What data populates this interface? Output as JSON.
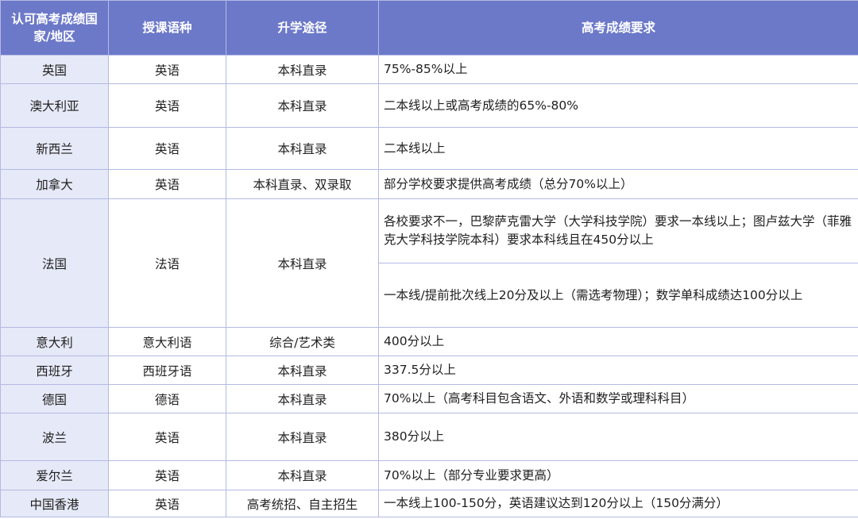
{
  "header": {
    "col1": "认可高考成绩国家/地区",
    "col2": "授课语种",
    "col3": "升学途径",
    "col4": "高考成绩要求"
  },
  "rows": [
    {
      "country": "英国",
      "lang": "英语",
      "path": "本科直录",
      "req": "75%-85%以上"
    },
    {
      "country": "澳大利亚",
      "lang": "英语",
      "path": "本科直录",
      "req": "二本线以上或高考成绩的65%-80%"
    },
    {
      "country": "新西兰",
      "lang": "英语",
      "path": "本科直录",
      "req": "二本线以上"
    },
    {
      "country": "加拿大",
      "lang": "英语",
      "path": "本科直录、双录取",
      "req": "部分学校要求提供高考成绩（总分70%以上）"
    },
    {
      "country": "法国",
      "lang": "法语",
      "path": "本科直录",
      "req": "各校要求不一，巴黎萨克雷大学（大学科技学院）要求一本线以上；图卢兹大学（菲雅克大学科技学院本科）要求本科线且在450分以上",
      "req2": "一本线/提前批次线上20分及以上（需选考物理）；数学单科成绩达100分以上"
    },
    {
      "country": "意大利",
      "lang": "意大利语",
      "path": "综合/艺术类",
      "req": "400分以上"
    },
    {
      "country": "西班牙",
      "lang": "西班牙语",
      "path": "本科直录",
      "req": "337.5分以上"
    },
    {
      "country": "德国",
      "lang": "德语",
      "path": "本科直录",
      "req": "70%以上（高考科目包含语文、外语和数学或理科科目）"
    },
    {
      "country": "波兰",
      "lang": "英语",
      "path": "本科直录",
      "req": "380分以上"
    },
    {
      "country": "爱尔兰",
      "lang": "英语",
      "path": "本科直录",
      "req": "70%以上（部分专业要求更高）"
    },
    {
      "country": "中国香港",
      "lang": "英语",
      "path": "高考统招、自主招生",
      "req": "一本线上100-150分，英语建议达到120分以上（150分满分）"
    }
  ]
}
